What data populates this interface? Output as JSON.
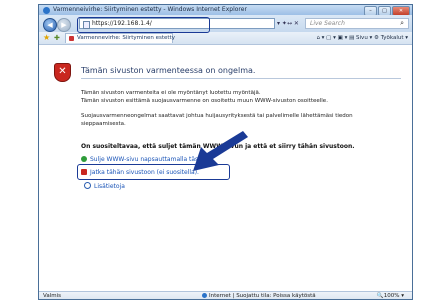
{
  "window": {
    "title": "Varmenneivirhe: Siirtyminen estetty - Windows Internet Explorer",
    "minimize": "–",
    "maximize": "□",
    "close": "✕"
  },
  "address_bar": {
    "url": "https://192.168.1.4/",
    "tools": "▾ ✦↔ ✕",
    "search_placeholder": "Live Search",
    "search_icon": "⌕"
  },
  "favorites_bar": {
    "star": "★",
    "add": "✚",
    "tab_title": "Varmennevirhe: Siirtyminen estetty",
    "toolbar": "⌂ ▾ ▢ ▾ ▣ ▾ ▤ Sivu ▾ ⚙ Työkalut ▾"
  },
  "content": {
    "heading": "Tämän sivuston varmenteessa on ongelma.",
    "p1_line1": "Tämän sivuston varmenteita ei ole myöntänyt luotettu myöntäjä.",
    "p1_line2": "Tämän sivuston esittämä suojausvarmenne on osoitettu muun WWW-sivuston osoitteelle.",
    "p2_line1": "Suojausvarmenneongelmat saattavat johtua huijausyrityksestä tai palvelimelle lähettämäsi tiedon",
    "p2_line2": "sieppaamisesta.",
    "recommend": "On suositeltavaa, että suljet tämän WWW-sivun ja että et siirry tähän sivustoon.",
    "close_link": "Sulje WWW-sivu napsauttamalla tästä.",
    "continue_link": "Jatka tähän sivustoon (ei suositella).",
    "more_info": "Lisätietoja"
  },
  "status_bar": {
    "status": "Valmis",
    "zone": "Internet | Suojattu tila: Poissa käytöstä",
    "zoom": "🔍100% ▾"
  },
  "colors": {
    "accent": "#1a3a96",
    "shield": "#c9271f",
    "link": "#1a54b7"
  }
}
